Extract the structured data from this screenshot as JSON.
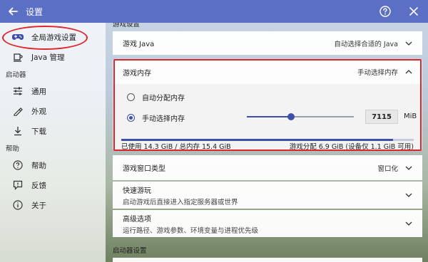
{
  "window": {
    "title": "设置",
    "back_icon": "arrow-left-icon",
    "help_icon": "question-circle-icon",
    "close_icon": "close-icon"
  },
  "sidebar": {
    "items": [
      {
        "label": "全局游戏设置",
        "icon": "gamepad-icon",
        "active": true
      },
      {
        "label": "Java 管理",
        "icon": "java-cup-icon"
      }
    ],
    "section_launcher": "启动器",
    "launcher_items": [
      {
        "label": "通用",
        "icon": "sliders-icon"
      },
      {
        "label": "外观",
        "icon": "palette-icon"
      },
      {
        "label": "下载",
        "icon": "download-icon"
      }
    ],
    "section_help": "帮助",
    "help_items": [
      {
        "label": "帮助",
        "icon": "help-circle-icon"
      },
      {
        "label": "反馈",
        "icon": "feedback-icon"
      },
      {
        "label": "关于",
        "icon": "info-icon"
      }
    ]
  },
  "main": {
    "top_section_label": "游戏设置",
    "game_java": {
      "label": "游戏 Java",
      "value": "自动选择合适的 Java"
    },
    "memory": {
      "label": "游戏内存",
      "value": "手动选择内存",
      "option_auto": "自动分配内存",
      "option_manual": "手动选择内存",
      "selected": "manual",
      "amount": "7115",
      "unit": "MiB",
      "slider_fraction": 0.41
    },
    "usage": {
      "left": "已使用 14.3 GiB / 总内存 15.4 GiB",
      "right": "游戏分配 6.9 GiB (设备仅 1.1 GiB 可用)",
      "used_fraction": 0.93,
      "allocated_fraction": 0.45
    },
    "window_type": {
      "label": "游戏窗口类型",
      "value": "窗口化"
    },
    "quick_play": {
      "label": "快速游玩",
      "sub": "启动游戏后直接进入指定服务器或世界"
    },
    "advanced": {
      "label": "高级选项",
      "sub": "运行路径、游戏参数、环境变量与进程优先级"
    },
    "launcher_section_label": "启动器设置"
  },
  "colors": {
    "titlebar": "#5b6fc4",
    "accent": "#3d4fa8",
    "highlight_ring": "#e0242b"
  }
}
